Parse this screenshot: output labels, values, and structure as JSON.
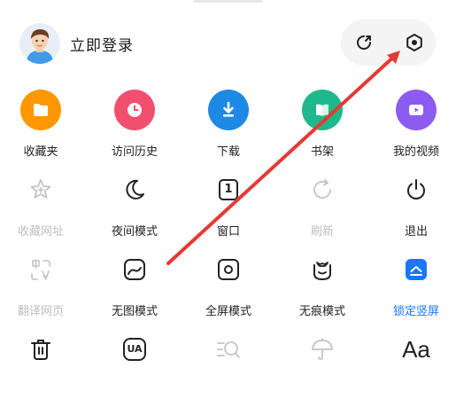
{
  "header": {
    "login_label": "立即登录",
    "avatar_icon": "user-avatar-icon",
    "share_icon": "share-refresh-icon",
    "settings_icon": "settings-icon"
  },
  "colors": {
    "accent": "#1677ff",
    "favorites": "#ff9800",
    "history": "#f0506e",
    "download": "#1e88e5",
    "bookshelf": "#1fb88c",
    "videos": "#8c5cf0",
    "annotation_arrow": "#e53935"
  },
  "menu": {
    "row1": [
      {
        "label": "收藏夹",
        "icon": "folder-icon"
      },
      {
        "label": "访问历史",
        "icon": "clock-icon"
      },
      {
        "label": "下载",
        "icon": "download-icon"
      },
      {
        "label": "书架",
        "icon": "book-icon"
      },
      {
        "label": "我的视频",
        "icon": "play-icon"
      }
    ],
    "row2": [
      {
        "label": "收藏网址",
        "icon": "star-plus-icon",
        "disabled": true
      },
      {
        "label": "夜间模式",
        "icon": "moon-icon"
      },
      {
        "label": "窗口",
        "icon": "window-count-icon",
        "badge": "1"
      },
      {
        "label": "刷新",
        "icon": "refresh-icon",
        "disabled": true
      },
      {
        "label": "退出",
        "icon": "power-icon"
      }
    ],
    "row3": [
      {
        "label": "翻译网页",
        "icon": "translate-icon",
        "disabled": true
      },
      {
        "label": "无图模式",
        "icon": "no-image-icon"
      },
      {
        "label": "全屏模式",
        "icon": "fullscreen-icon"
      },
      {
        "label": "无痕模式",
        "icon": "incognito-icon"
      },
      {
        "label": "锁定竖屏",
        "icon": "lock-portrait-icon",
        "active": true
      }
    ],
    "row4": [
      {
        "icon": "trash-icon"
      },
      {
        "icon": "user-agent-icon",
        "text": "UA"
      },
      {
        "icon": "find-in-page-icon",
        "disabled": true
      },
      {
        "icon": "umbrella-icon",
        "disabled": true
      },
      {
        "icon": "font-size-icon",
        "text": "Aa"
      }
    ]
  }
}
